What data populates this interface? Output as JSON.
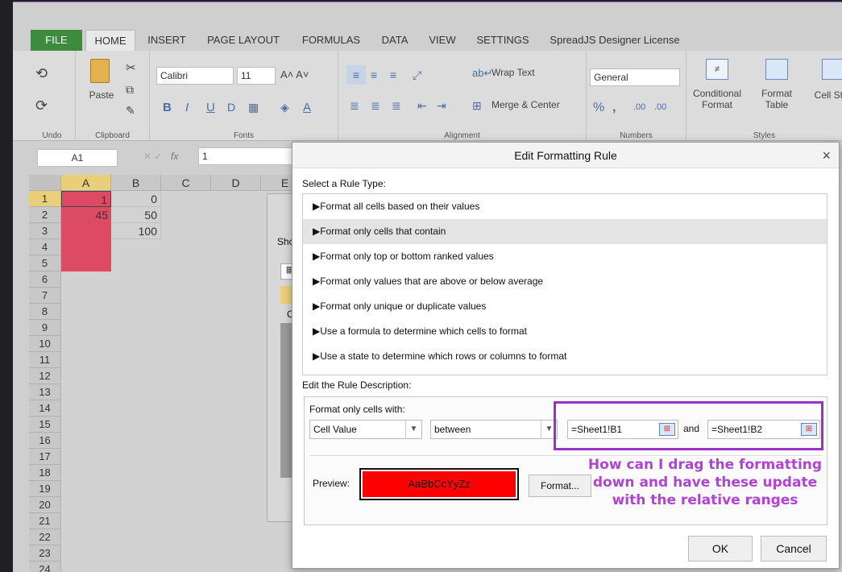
{
  "tabs": [
    "FILE",
    "HOME",
    "INSERT",
    "PAGE LAYOUT",
    "FORMULAS",
    "DATA",
    "VIEW",
    "SETTINGS",
    "SpreadJS Designer License"
  ],
  "ribbon": {
    "undo_label": "Undo",
    "clipboard_label": "Clipboard",
    "paste_label": "Paste",
    "font_name": "Calibri",
    "font_size": "11",
    "fonts_label": "Fonts",
    "wrap_text": "Wrap Text",
    "merge_center": "Merge & Center",
    "alignment_label": "Alignment",
    "number_format": "General",
    "numbers_label": "Numbers",
    "conditional_format": "Conditional\nFormat",
    "format_table": "Format\nTable",
    "cell_styles": "Cell Styles",
    "styles_label": "Styles"
  },
  "formula_bar": {
    "name_box": "A1",
    "fx": "fx",
    "value": "1"
  },
  "grid": {
    "columns": [
      "A",
      "B",
      "C",
      "D",
      "E"
    ],
    "rows": [
      "1",
      "2",
      "3",
      "4",
      "5",
      "6",
      "7",
      "8",
      "9",
      "10",
      "11",
      "12",
      "13",
      "14",
      "15",
      "16",
      "17",
      "18",
      "19",
      "20",
      "21",
      "22",
      "23",
      "24"
    ],
    "cells": {
      "A1": "1",
      "B1": "0",
      "A2": "45",
      "B2": "50",
      "B3": "100"
    },
    "highlight_color": "#dc4b63"
  },
  "behind_dialog": {
    "show_label": "Show",
    "cell_label": "Cell"
  },
  "dialog": {
    "title": "Edit Formatting Rule",
    "close": "×",
    "select_type_label": "Select a Rule Type:",
    "rules": [
      "▶Format all cells based on their values",
      "▶Format only cells that contain",
      "▶Format only top or bottom ranked values",
      "▶Format only values that are above or below average",
      "▶Format only unique or duplicate values",
      "▶Use a formula to determine which cells to format",
      "▶Use a state to determine which rows or columns to format"
    ],
    "selected_rule": 1,
    "edit_desc_label": "Edit the Rule Description:",
    "format_only_label": "Format only cells with:",
    "condition_type": "Cell Value",
    "operator": "between",
    "value1": "=Sheet1!B1",
    "and_label": "and",
    "value2": "=Sheet1!B2",
    "preview_label": "Preview:",
    "preview_text": "AaBbCcYyZz",
    "preview_color": "#ff0000",
    "format_button": "Format...",
    "ok_button": "OK",
    "cancel_button": "Cancel"
  },
  "annotation": "How can I drag the formatting down and have these update with the relative ranges"
}
